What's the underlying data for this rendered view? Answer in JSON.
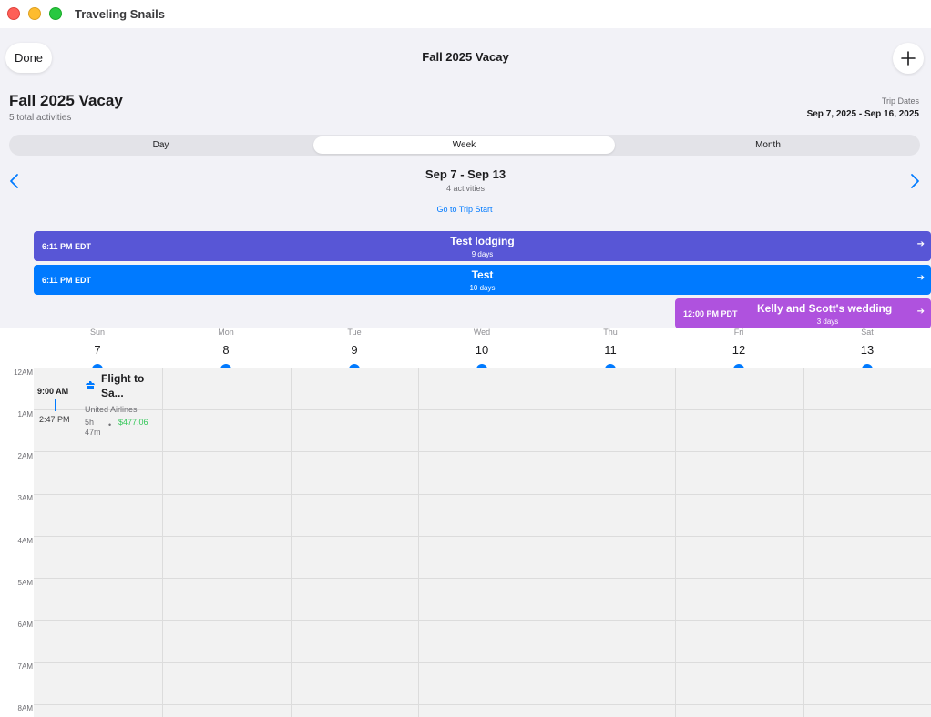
{
  "window": {
    "title": "Traveling Snails"
  },
  "nav": {
    "done_label": "Done",
    "title": "Fall 2025 Vacay",
    "add_icon": "plus-icon"
  },
  "trip": {
    "name": "Fall 2025 Vacay",
    "activity_count": "5 total activities",
    "dates_label": "Trip Dates",
    "dates_value": "Sep 7, 2025 - Sep 16, 2025"
  },
  "view_picker": {
    "options": [
      "Day",
      "Week",
      "Month"
    ],
    "selected": "Week"
  },
  "week": {
    "range": "Sep 7 - Sep 13",
    "count": "4 activities",
    "goto_label": "Go to Trip Start",
    "prev_icon": "chevron-left-icon",
    "next_icon": "chevron-right-icon"
  },
  "multi_day_events": [
    {
      "time": "6:11 PM EDT",
      "title": "Test lodging",
      "duration": "9 days",
      "color": "#5856d6"
    },
    {
      "time": "6:11 PM EDT",
      "title": "Test",
      "duration": "10 days",
      "color": "#007aff"
    },
    {
      "time": "12:00 PM PDT",
      "title": "Kelly and Scott's wedding",
      "duration": "3 days",
      "color": "#af52de"
    }
  ],
  "days": [
    {
      "name": "Sun",
      "num": "7"
    },
    {
      "name": "Mon",
      "num": "8"
    },
    {
      "name": "Tue",
      "num": "9"
    },
    {
      "name": "Wed",
      "num": "10"
    },
    {
      "name": "Thu",
      "num": "11"
    },
    {
      "name": "Fri",
      "num": "12"
    },
    {
      "name": "Sat",
      "num": "13"
    }
  ],
  "hours": [
    "12AM",
    "1AM",
    "2AM",
    "3AM",
    "4AM",
    "5AM",
    "6AM",
    "7AM",
    "8AM"
  ],
  "flight": {
    "start": "9:00 AM",
    "end": "2:47 PM",
    "title": "Flight to Sa...",
    "airline": "United Airlines",
    "duration": "5h 47m",
    "separator": "•",
    "price": "$477.06",
    "icon": "airplane-icon"
  },
  "colors": {
    "accent": "#007aff",
    "price": "#34c759"
  }
}
